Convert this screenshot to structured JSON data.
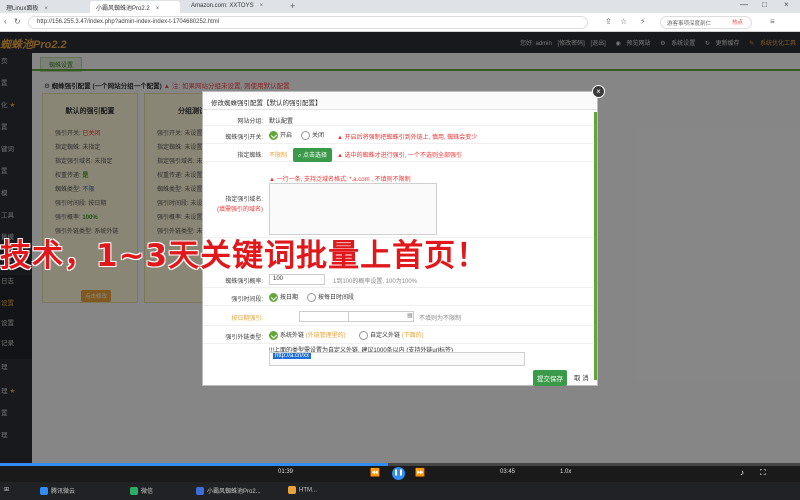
{
  "browser": {
    "tabs": [
      {
        "label": "理Linux面板"
      },
      {
        "label": "小霸风蜘蛛池Pro2.2"
      },
      {
        "label": "Amazon.com: XXTOYS"
      }
    ],
    "url": "http://156.255.3.47/index.php?admin-index-index-t-1704680252.html",
    "search_placeholder": "游客事项深度剖仁",
    "hot_label": "热点"
  },
  "app": {
    "logo": "蜘蛛池Pro2.2",
    "header_links": [
      "您好: admin",
      "[修改密码]",
      "[退出]",
      "预览网站",
      "系统设置",
      "更新缓存",
      "系统优化工具"
    ]
  },
  "sidebar": {
    "items": [
      {
        "label": "页"
      },
      {
        "label": "置"
      },
      {
        "label": "化"
      },
      {
        "label": "置"
      },
      {
        "label": "键词"
      },
      {
        "label": "置"
      },
      {
        "label": "模"
      },
      {
        "label": "工具"
      },
      {
        "label": "量模"
      },
      {
        "label": "化工具"
      },
      {
        "label": "日志"
      },
      {
        "label": "设置"
      },
      {
        "label": "设置"
      },
      {
        "label": "记录"
      },
      {
        "label": "理"
      },
      {
        "label": "理"
      },
      {
        "label": "置"
      },
      {
        "label": "理"
      }
    ]
  },
  "content": {
    "tab": "蜘蛛设置",
    "notice_title": "蜘蛛强引配置 (一个网站分组一个配置)",
    "notice_warn": "注: 如果网站分组未设置, 则使用默认配置",
    "cards": [
      {
        "title": "默认的强引配置",
        "rows": [
          {
            "k": "强引开关:",
            "v": "已关闭"
          },
          {
            "k": "指定蜘蛛:",
            "v": "未指定"
          },
          {
            "k": "指定强引域名:",
            "v": "未指定"
          },
          {
            "k": "权重传递:",
            "v": "是"
          },
          {
            "k": "蜘蛛类型:",
            "v": "不限"
          },
          {
            "k": "强引时间段:",
            "v": "按日期"
          },
          {
            "k": "强引概率:",
            "v": "100%"
          },
          {
            "k": "强引外链类型:",
            "v": "系统外链"
          }
        ],
        "button": "点击修改"
      },
      {
        "title": "分组测试",
        "rows": [
          {
            "k": "强引开关:",
            "v": "未设置"
          },
          {
            "k": "指定蜘蛛:",
            "v": "未设置"
          },
          {
            "k": "指定强引域名:",
            "v": "未设置"
          },
          {
            "k": "权重传递:",
            "v": "未设置"
          },
          {
            "k": "蜘蛛类型:",
            "v": "未设置"
          },
          {
            "k": "强引时间段:",
            "v": "未设置"
          },
          {
            "k": "强引概率:",
            "v": "未设置"
          },
          {
            "k": "强引外链类型:",
            "v": "未设置"
          }
        ]
      }
    ]
  },
  "modal": {
    "title": "修改蜘蛛强引配置【默认的强引配置】",
    "close": "×",
    "fields": {
      "group_label": "网站分组:",
      "group_value": "默认配置",
      "switch_label": "蜘蛛强引开关:",
      "switch_on": "开启",
      "switch_off": "关闭",
      "switch_warn": "开启后将强制把蜘蛛引到外链上, 慎用, 蜘蛛会变少",
      "spider_label": "指定蜘蛛:",
      "spider_value": "不限制",
      "spider_button": "点击选择",
      "spider_warn": "选中的蜘蛛才进行强引, 一个不选则全部强引",
      "domain_label": "指定强引域名:",
      "domain_sublabel": "(填需强引的域名)",
      "domain_hint": "一行一条, 支持泛域名格式: *.a.com , 不填则不限制",
      "prob_label": "蜘蛛强引概率:",
      "prob_value": "100",
      "prob_hint": "1到100的概率设置, 100为100%",
      "time_label": "强引时间段:",
      "time_opt1": "按日期",
      "time_opt2": "按每日时间段",
      "date_label": "按日期强引:",
      "date_sep": "至",
      "date_hint": "不填则为不限制",
      "link_label": "强引外链类型:",
      "link_opt1": "系统外链",
      "link_opt1_note": "(外链管理里的)",
      "link_opt2": "自定义外链",
      "link_opt2_note": "(下面的)",
      "link_hint": "!!!上面的类型需设置为自定义外链, 建议1000条以内 (支持外链url标签)",
      "link_value": "http://a.cn/xx"
    },
    "submit": "提交保存",
    "cancel": "取 消"
  },
  "promo": "技术，1~3天关键词批量上首页！",
  "player": {
    "current_time": "01:39",
    "total_time": "03:45",
    "progress": 0.485,
    "speed": "1.0x"
  },
  "taskbar": {
    "items": [
      {
        "label": "腾讯微云",
        "color": "#2f8df5"
      },
      {
        "label": "微信",
        "color": "#2aae67"
      },
      {
        "label": "小霸风蜘蛛池Pro2...",
        "color": "#3a6fd9"
      },
      {
        "label": "HTM...",
        "color": "#e8a33a"
      }
    ]
  }
}
